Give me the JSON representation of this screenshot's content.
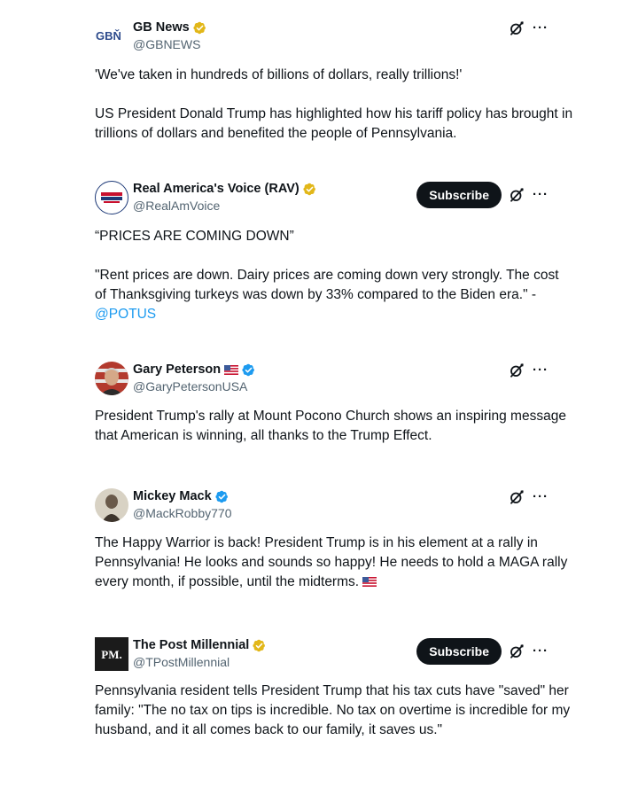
{
  "posts": [
    {
      "name": "GB News",
      "handle": "@GBNEWS",
      "avatar_text": "GBŇ",
      "badge": "gold",
      "has_subscribe": false,
      "paragraphs": [
        "'We've taken in hundreds of billions of dollars, really trillions!'",
        "US President Donald Trump has highlighted how his tariff policy has brought in trillions of dollars and benefited the people of Pennsylvania."
      ]
    },
    {
      "name": "Real America's Voice (RAV)",
      "handle": "@RealAmVoice",
      "badge": "gold",
      "has_subscribe": true,
      "subscribe_label": "Subscribe",
      "paragraphs": [
        "“PRICES ARE COMING DOWN”",
        "\"Rent prices are down. Dairy prices are coming down very strongly. The cost of Thanksgiving turkeys was down by 33% compared to the Biden era.\" - "
      ],
      "mention": "@POTUS"
    },
    {
      "name": "Gary Peterson",
      "handle": "@GaryPetersonUSA",
      "badge": "blue",
      "has_flag": true,
      "has_subscribe": false,
      "paragraphs": [
        "President Trump's rally at Mount Pocono Church shows an inspiring message that American is winning, all thanks to the Trump Effect."
      ]
    },
    {
      "name": "Mickey Mack",
      "handle": "@MackRobby770",
      "badge": "blue",
      "has_subscribe": false,
      "paragraphs": [
        "The Happy Warrior is back! President Trump is in his element at a rally in Pennsylvania! He looks and sounds so happy! He needs to hold a MAGA rally every month, if possible, until the midterms."
      ]
    },
    {
      "name": "The Post Millennial",
      "handle": "@TPostMillennial",
      "avatar_text": "PM.",
      "badge": "gold",
      "has_subscribe": true,
      "subscribe_label": "Subscribe",
      "paragraphs": [
        "Pennsylvania resident tells President Trump that his tax cuts have \"saved\" her family: \"The no tax on tips is incredible. No tax on overtime is incredible for my husband, and it all comes back to our family, it saves us.\""
      ]
    }
  ],
  "more_label": "···",
  "colors": {
    "text": "#0f1419",
    "secondary": "#536471",
    "link": "#1d9bf0",
    "verified_blue": "#1d9bf0",
    "verified_gold": "#e2b719"
  }
}
